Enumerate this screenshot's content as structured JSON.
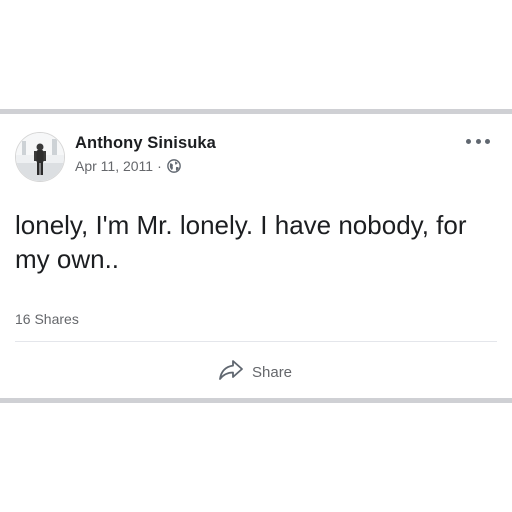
{
  "post": {
    "author_name": "Anthony Sinisuka",
    "date": "Apr 11, 2011",
    "separator": "·",
    "privacy_icon": "globe-icon",
    "more_icon": "more-options-icon",
    "text": "lonely, I'm Mr. lonely. I have nobody, for my own..",
    "shares": "16 Shares",
    "actions": {
      "share_label": "Share",
      "share_icon": "share-arrow-icon"
    }
  },
  "colors": {
    "card_border": "#cfd0d4",
    "author_text": "#1c1e21",
    "meta_text": "#65676b",
    "divider": "#e4e6eb"
  }
}
